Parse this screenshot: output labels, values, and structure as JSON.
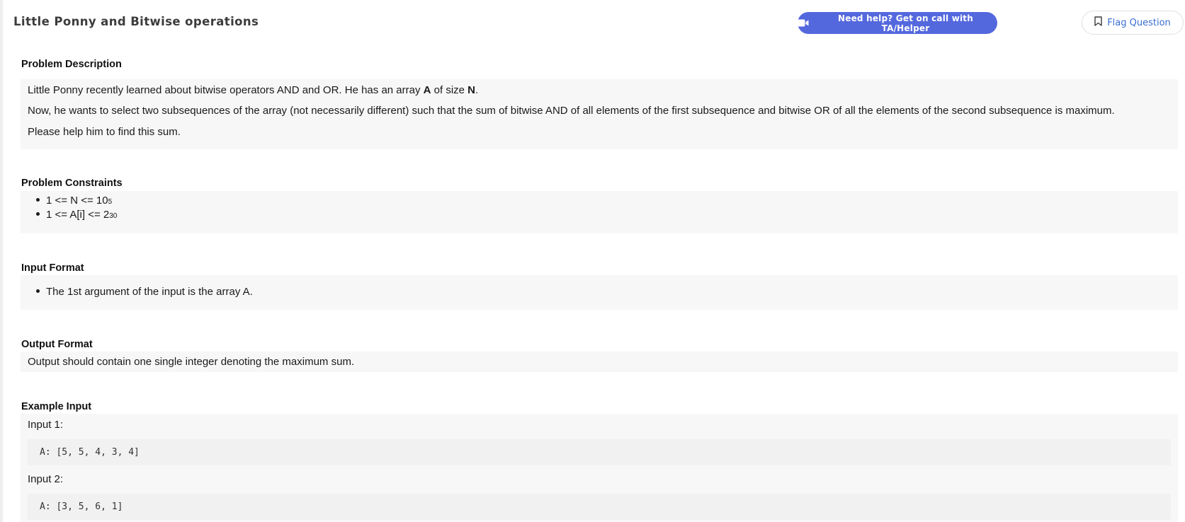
{
  "header": {
    "title": "Little Ponny and Bitwise operations",
    "help_button_label": "Need help? Get on call with TA/Helper",
    "flag_button_label": "Flag Question"
  },
  "colors": {
    "accent": "#5468de",
    "flag_text": "#3a6fd1",
    "panel_bg": "#f7f7f7"
  },
  "problem_description": {
    "title": "Problem Description",
    "line1_part1": "Little Ponny recently learned about bitwise operators AND and OR. He has an array ",
    "line1_var1": "A",
    "line1_part2": " of size ",
    "line1_var2": "N",
    "line1_part3": ".",
    "line2": "Now, he wants to select two subsequences of the array (not necessarily different) such that the sum of bitwise AND of all elements of the first subsequence and bitwise OR of all the elements of the second subsequence is maximum.",
    "line3": "Please help him to find this sum."
  },
  "problem_constraints": {
    "title": "Problem Constraints",
    "items": [
      {
        "text": "1 <= N <= 10",
        "sup": "5"
      },
      {
        "text": "1 <= A[i] <= 2",
        "sup": "30"
      }
    ]
  },
  "input_format": {
    "title": "Input Format",
    "items": [
      "The 1st argument of the input is the array A."
    ]
  },
  "output_format": {
    "title": "Output Format",
    "text": "Output should contain one single integer denoting the maximum sum."
  },
  "example_input": {
    "title": "Example Input",
    "inputs": [
      {
        "label": "Input 1:",
        "code": "A: [5, 5, 4, 3, 4]"
      },
      {
        "label": "Input 2:",
        "code": "A: [3, 5, 6, 1]"
      }
    ]
  }
}
